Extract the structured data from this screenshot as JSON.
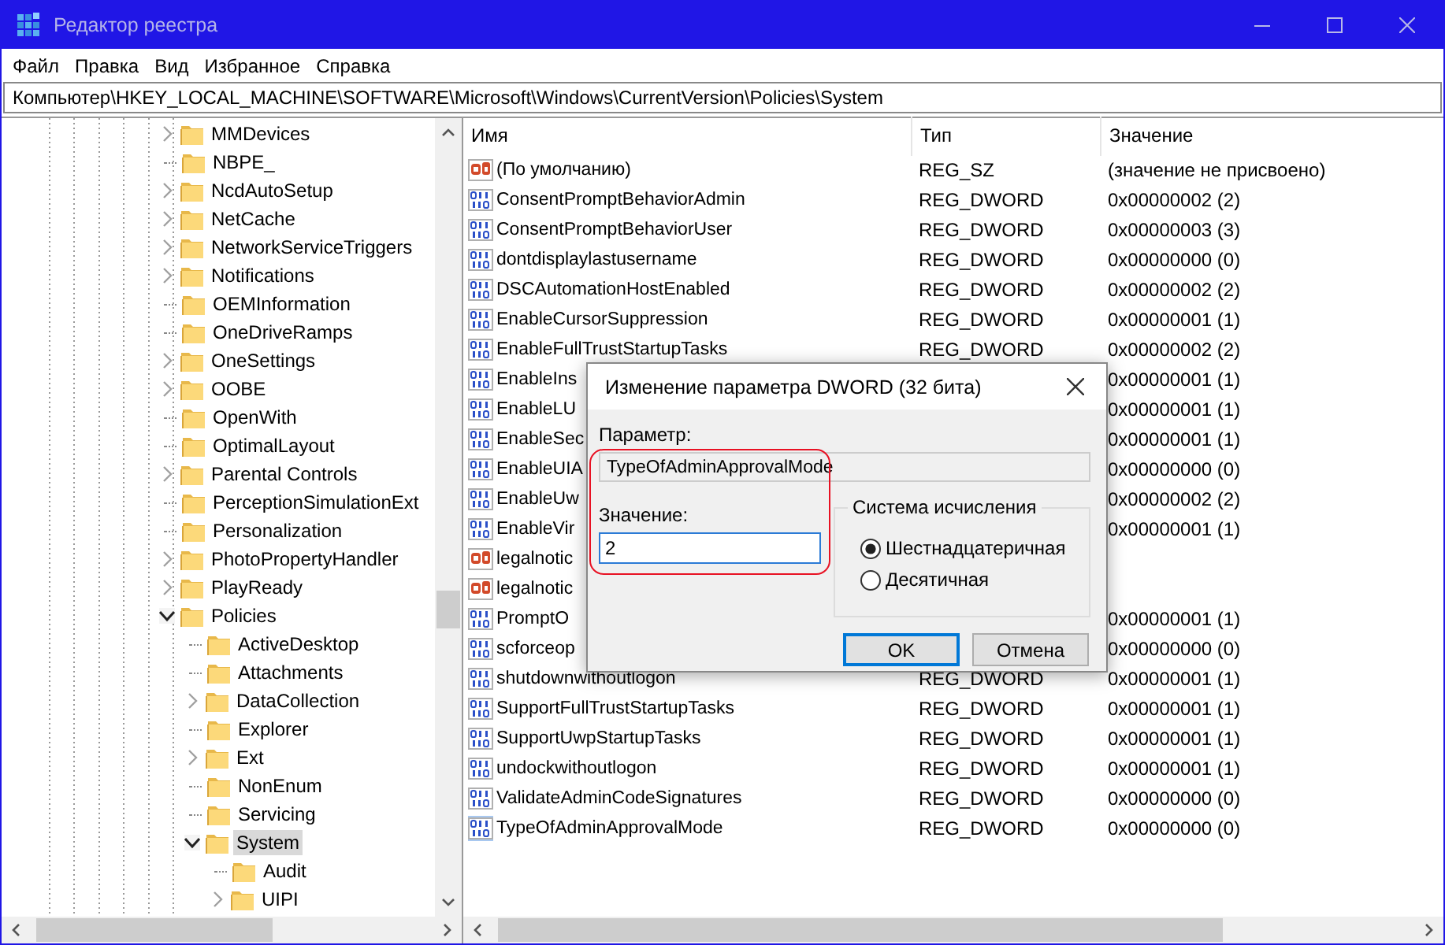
{
  "window": {
    "title": "Редактор реестра"
  },
  "menu": [
    "Файл",
    "Правка",
    "Вид",
    "Избранное",
    "Справка"
  ],
  "address": "Компьютер\\HKEY_LOCAL_MACHINE\\SOFTWARE\\Microsoft\\Windows\\CurrentVersion\\Policies\\System",
  "tree": [
    {
      "label": "MMDevices",
      "kind": "branch",
      "expanded": false,
      "selected": false
    },
    {
      "label": "NBPE_",
      "kind": "leaf",
      "selected": false
    },
    {
      "label": "NcdAutoSetup",
      "kind": "branch",
      "expanded": false,
      "selected": false
    },
    {
      "label": "NetCache",
      "kind": "branch",
      "expanded": false,
      "selected": false
    },
    {
      "label": "NetworkServiceTriggers",
      "kind": "branch",
      "expanded": false,
      "selected": false
    },
    {
      "label": "Notifications",
      "kind": "branch",
      "expanded": false,
      "selected": false
    },
    {
      "label": "OEMInformation",
      "kind": "leaf",
      "selected": false
    },
    {
      "label": "OneDriveRamps",
      "kind": "leaf",
      "selected": false
    },
    {
      "label": "OneSettings",
      "kind": "branch",
      "expanded": false,
      "selected": false
    },
    {
      "label": "OOBE",
      "kind": "branch",
      "expanded": false,
      "selected": false
    },
    {
      "label": "OpenWith",
      "kind": "leaf",
      "selected": false
    },
    {
      "label": "OptimalLayout",
      "kind": "leaf",
      "selected": false
    },
    {
      "label": "Parental Controls",
      "kind": "branch",
      "expanded": false,
      "selected": false
    },
    {
      "label": "PerceptionSimulationExt",
      "kind": "leaf",
      "selected": false
    },
    {
      "label": "Personalization",
      "kind": "leaf",
      "selected": false
    },
    {
      "label": "PhotoPropertyHandler",
      "kind": "branch",
      "expanded": false,
      "selected": false
    },
    {
      "label": "PlayReady",
      "kind": "branch",
      "expanded": false,
      "selected": false
    },
    {
      "label": "Policies",
      "kind": "branch",
      "expanded": true,
      "selected": false,
      "children": [
        {
          "label": "ActiveDesktop",
          "kind": "leaf",
          "selected": false
        },
        {
          "label": "Attachments",
          "kind": "leaf",
          "selected": false
        },
        {
          "label": "DataCollection",
          "kind": "branch",
          "expanded": false,
          "selected": false
        },
        {
          "label": "Explorer",
          "kind": "leaf",
          "selected": false
        },
        {
          "label": "Ext",
          "kind": "branch",
          "expanded": false,
          "selected": false
        },
        {
          "label": "NonEnum",
          "kind": "leaf",
          "selected": false
        },
        {
          "label": "Servicing",
          "kind": "leaf",
          "selected": false
        },
        {
          "label": "System",
          "kind": "branch",
          "expanded": true,
          "selected": true,
          "children": [
            {
              "label": "Audit",
              "kind": "leaf",
              "selected": false
            },
            {
              "label": "UIPI",
              "kind": "branch",
              "expanded": false,
              "selected": false
            }
          ]
        }
      ]
    }
  ],
  "list": {
    "columns": [
      "Имя",
      "Тип",
      "Значение"
    ],
    "rows": [
      {
        "kind": "string",
        "name": "(По умолчанию)",
        "type": "REG_SZ",
        "value": "(значение не присвоено)",
        "selected": false
      },
      {
        "kind": "dword",
        "name": "ConsentPromptBehaviorAdmin",
        "type": "REG_DWORD",
        "value": "0x00000002 (2)",
        "selected": false
      },
      {
        "kind": "dword",
        "name": "ConsentPromptBehaviorUser",
        "type": "REG_DWORD",
        "value": "0x00000003 (3)",
        "selected": false
      },
      {
        "kind": "dword",
        "name": "dontdisplaylastusername",
        "type": "REG_DWORD",
        "value": "0x00000000 (0)",
        "selected": false
      },
      {
        "kind": "dword",
        "name": "DSCAutomationHostEnabled",
        "type": "REG_DWORD",
        "value": "0x00000002 (2)",
        "selected": false
      },
      {
        "kind": "dword",
        "name": "EnableCursorSuppression",
        "type": "REG_DWORD",
        "value": "0x00000001 (1)",
        "selected": false
      },
      {
        "kind": "dword",
        "name": "EnableFullTrustStartupTasks",
        "type": "REG_DWORD",
        "value": "0x00000002 (2)",
        "selected": false
      },
      {
        "kind": "dword",
        "name": "EnableIns",
        "value": "0x00000001 (1)",
        "selected": false
      },
      {
        "kind": "dword",
        "name": "EnableLU",
        "value": "0x00000001 (1)",
        "selected": false
      },
      {
        "kind": "dword",
        "name": "EnableSec",
        "value": "0x00000001 (1)",
        "selected": false
      },
      {
        "kind": "dword",
        "name": "EnableUIA",
        "value": "0x00000000 (0)",
        "selected": false
      },
      {
        "kind": "dword",
        "name": "EnableUw",
        "value": "0x00000002 (2)",
        "selected": false
      },
      {
        "kind": "dword",
        "name": "EnableVir",
        "value": "0x00000001 (1)",
        "selected": false
      },
      {
        "kind": "string",
        "name": "legalnotic",
        "selected": false
      },
      {
        "kind": "string",
        "name": "legalnotic",
        "selected": false
      },
      {
        "kind": "dword",
        "name": "PromptO",
        "value": "0x00000001 (1)",
        "selected": false
      },
      {
        "kind": "dword",
        "name": "scforceop",
        "value": "0x00000000 (0)",
        "selected": false
      },
      {
        "kind": "dword",
        "name": "shutdownwithoutlogon",
        "type": "REG_DWORD",
        "value": "0x00000001 (1)",
        "selected": false
      },
      {
        "kind": "dword",
        "name": "SupportFullTrustStartupTasks",
        "type": "REG_DWORD",
        "value": "0x00000001 (1)",
        "selected": false
      },
      {
        "kind": "dword",
        "name": "SupportUwpStartupTasks",
        "type": "REG_DWORD",
        "value": "0x00000001 (1)",
        "selected": false
      },
      {
        "kind": "dword",
        "name": "undockwithoutlogon",
        "type": "REG_DWORD",
        "value": "0x00000001 (1)",
        "selected": false
      },
      {
        "kind": "dword",
        "name": "ValidateAdminCodeSignatures",
        "type": "REG_DWORD",
        "value": "0x00000000 (0)",
        "selected": false
      },
      {
        "kind": "dword",
        "name": "TypeOfAdminApprovalMode",
        "type": "REG_DWORD",
        "value": "0x00000000 (0)",
        "selected": true
      }
    ]
  },
  "dialog": {
    "title": "Изменение параметра DWORD (32 бита)",
    "param_label": "Параметр:",
    "param_value": "TypeOfAdminApprovalMode",
    "value_label": "Значение:",
    "value": "2",
    "base": {
      "legend": "Система исчисления",
      "options": [
        {
          "label": "Шестнадцатеричная",
          "selected": true
        },
        {
          "label": "Десятичная",
          "selected": false
        }
      ]
    },
    "buttons": [
      {
        "label": "OK",
        "focused": true
      },
      {
        "label": "Отмена",
        "focused": false
      }
    ]
  }
}
